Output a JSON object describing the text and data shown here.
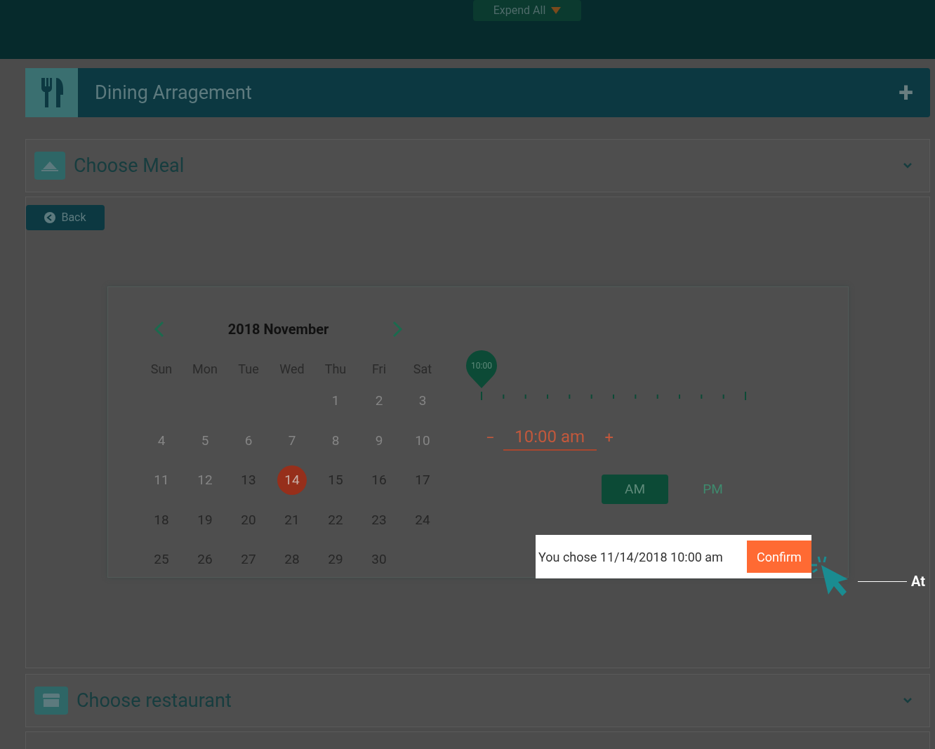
{
  "top_bar": {
    "expand_button": "Expend All"
  },
  "section": {
    "title": "Dining Arragement",
    "expand_symbol": "+"
  },
  "panels": [
    {
      "title": "Choose Meal"
    },
    {
      "title": "Choose restaurant"
    }
  ],
  "back_button": "Back",
  "calendar": {
    "title": "2018 November",
    "weekdays": [
      "Sun",
      "Mon",
      "Tue",
      "Wed",
      "Thu",
      "Fri",
      "Sat"
    ],
    "weeks": [
      [
        {
          "kind": "blank"
        },
        {
          "kind": "blank"
        },
        {
          "kind": "blank"
        },
        {
          "kind": "blank"
        },
        {
          "kind": "day",
          "day": "1",
          "disabled": true,
          "selected": false
        },
        {
          "kind": "day",
          "day": "2",
          "disabled": true,
          "selected": false
        },
        {
          "kind": "day",
          "day": "3",
          "disabled": true,
          "selected": false
        }
      ],
      [
        {
          "kind": "day",
          "day": "4",
          "disabled": true,
          "selected": false
        },
        {
          "kind": "day",
          "day": "5",
          "disabled": true,
          "selected": false
        },
        {
          "kind": "day",
          "day": "6",
          "disabled": true,
          "selected": false
        },
        {
          "kind": "day",
          "day": "7",
          "disabled": true,
          "selected": false
        },
        {
          "kind": "day",
          "day": "8",
          "disabled": true,
          "selected": false
        },
        {
          "kind": "day",
          "day": "9",
          "disabled": true,
          "selected": false
        },
        {
          "kind": "day",
          "day": "10",
          "disabled": true,
          "selected": false
        }
      ],
      [
        {
          "kind": "day",
          "day": "11",
          "disabled": true,
          "selected": false
        },
        {
          "kind": "day",
          "day": "12",
          "disabled": true,
          "selected": false
        },
        {
          "kind": "day",
          "day": "13",
          "disabled": false,
          "selected": false
        },
        {
          "kind": "day",
          "day": "14",
          "disabled": false,
          "selected": true
        },
        {
          "kind": "day",
          "day": "15",
          "disabled": false,
          "selected": false
        },
        {
          "kind": "day",
          "day": "16",
          "disabled": false,
          "selected": false
        },
        {
          "kind": "day",
          "day": "17",
          "disabled": false,
          "selected": false
        }
      ],
      [
        {
          "kind": "day",
          "day": "18",
          "disabled": false,
          "selected": false
        },
        {
          "kind": "day",
          "day": "19",
          "disabled": false,
          "selected": false
        },
        {
          "kind": "day",
          "day": "20",
          "disabled": false,
          "selected": false
        },
        {
          "kind": "day",
          "day": "21",
          "disabled": false,
          "selected": false
        },
        {
          "kind": "day",
          "day": "22",
          "disabled": false,
          "selected": false
        },
        {
          "kind": "day",
          "day": "23",
          "disabled": false,
          "selected": false
        },
        {
          "kind": "day",
          "day": "24",
          "disabled": false,
          "selected": false
        }
      ],
      [
        {
          "kind": "day",
          "day": "25",
          "disabled": false,
          "selected": false
        },
        {
          "kind": "day",
          "day": "26",
          "disabled": false,
          "selected": false
        },
        {
          "kind": "day",
          "day": "27",
          "disabled": false,
          "selected": false
        },
        {
          "kind": "day",
          "day": "28",
          "disabled": false,
          "selected": false
        },
        {
          "kind": "day",
          "day": "29",
          "disabled": false,
          "selected": false
        },
        {
          "kind": "day",
          "day": "30",
          "disabled": false,
          "selected": false
        },
        {
          "kind": "blank"
        }
      ]
    ]
  },
  "time": {
    "slider": {
      "label": "10:00",
      "level": 0
    },
    "minus": "−",
    "value": "10:00 am",
    "plus": "+",
    "periods": [
      {
        "label": "AM",
        "selected": true
      },
      {
        "label": "PM",
        "selected": false
      }
    ]
  },
  "summary": {
    "text": "You chose 11/14/2018 10:00 am",
    "confirm": "Confirm"
  },
  "callout": {
    "text": "At"
  }
}
